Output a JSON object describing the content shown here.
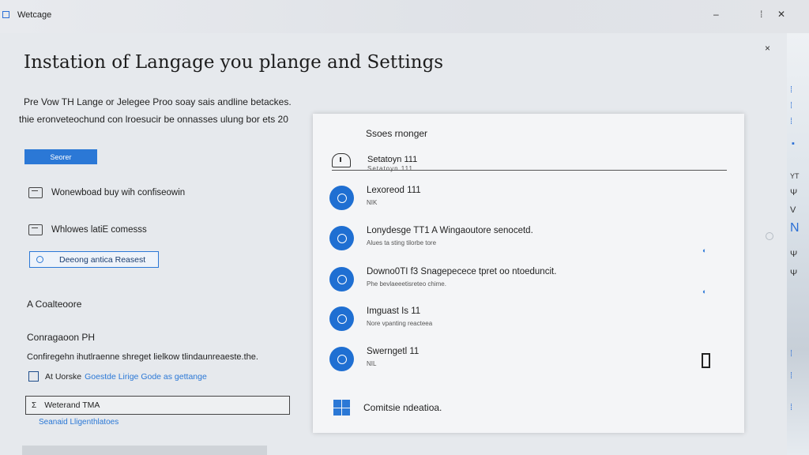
{
  "window": {
    "title": "Wetcage",
    "minimize": "–",
    "maximize": "⁞",
    "close": "✕",
    "dialog_close": "×"
  },
  "main": {
    "title": "Instation of Langage you plange and Settings",
    "desc_line1": "Pre Vow TH Lange or Jelegee Proo soay sais andline betackes.",
    "desc_line2": "thie eronveteochund con lroesucir be onnasses ulung bor ets 20",
    "primary_button": "Seorer",
    "options": [
      {
        "label": "Wonewboad buy wih confiseowin",
        "icon": "monitor-icon"
      },
      {
        "label": "Whlowes latiE comesss",
        "icon": "keyboard-icon"
      }
    ],
    "outline_button": "Deeong antica Reasest",
    "section_heading": "A Coalteoore",
    "sub_heading": "Conragaoon PH",
    "sub_desc": "Confiregehn ihutlraenne shreget lielkow tlindaunreaeste.the.",
    "checkbox": {
      "prefix": "At Uorske",
      "link": "Goestde Lirige Gode as gettange"
    },
    "text_field": {
      "icon_glyph": "Σ",
      "value": "Weterand TMA"
    },
    "link_below": "Seanaid Lligenthlatoes"
  },
  "panel": {
    "title": "Ssoes rnonger",
    "search": {
      "value": "Setatoyn 111",
      "sub": "Setatoyn 111"
    },
    "languages": [
      {
        "name": "Lexoreod 111",
        "sub": "NIK"
      },
      {
        "name": "Lonydesge TT1 A Wingaoutore senocetd.",
        "sub": "Alues ta sting tilorbe tore",
        "status": "◐"
      },
      {
        "name": "Downo0TI f3 Snagepecece tpret oo ntoeduncit.",
        "sub": "Phe bevlaeeetisreteo chime.",
        "status": "◐"
      },
      {
        "name": "Imguast Is 11",
        "sub": "Nore vpanting reacteea"
      },
      {
        "name": "Swerngetl 11",
        "sub": "NIL"
      }
    ],
    "footer": "Comitsie ndeatioa."
  },
  "edge": {
    "glyphs": [
      "⁞",
      "⁞",
      "⁞",
      "▪",
      "YT",
      "Ψ",
      "V",
      "N",
      "Ψ",
      "Ψ",
      "⁞",
      "⁞",
      "⁞"
    ]
  },
  "colors": {
    "accent": "#2b78d6",
    "icon_blue": "#1f6fd2"
  }
}
